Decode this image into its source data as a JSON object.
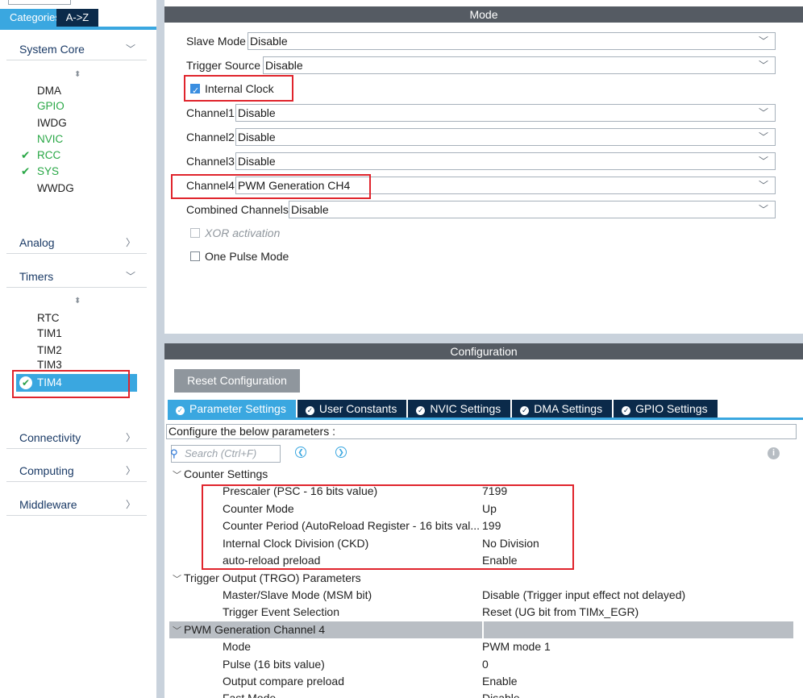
{
  "sidebar": {
    "tabs": {
      "categories": "Categories",
      "az": "A->Z"
    },
    "categories": [
      {
        "label": "System Core",
        "chevron": "﹀"
      },
      {
        "label": "Analog",
        "chevron": "〉"
      },
      {
        "label": "Timers",
        "chevron": "﹀"
      },
      {
        "label": "Connectivity",
        "chevron": "〉"
      },
      {
        "label": "Computing",
        "chevron": "〉"
      },
      {
        "label": "Middleware",
        "chevron": "〉"
      }
    ],
    "system_core_items": [
      "DMA",
      "GPIO",
      "IWDG",
      "NVIC",
      "RCC",
      "SYS",
      "WWDG"
    ],
    "timers_items": [
      "RTC",
      "TIM1",
      "TIM2",
      "TIM3",
      "TIM4"
    ],
    "sort_glyph": "⬍",
    "check_glyph": "✔"
  },
  "mode": {
    "header": "Mode",
    "slave_mode": {
      "label": "Slave Mode",
      "value": "Disable"
    },
    "trigger_source": {
      "label": "Trigger Source",
      "value": "Disable"
    },
    "internal_clock": {
      "label": "Internal Clock",
      "checked": true
    },
    "channel1": {
      "label": "Channel1",
      "value": "Disable"
    },
    "channel2": {
      "label": "Channel2",
      "value": "Disable"
    },
    "channel3": {
      "label": "Channel3",
      "value": "Disable"
    },
    "channel4": {
      "label": "Channel4",
      "value": "PWM Generation CH4"
    },
    "combined_channels": {
      "label": "Combined Channels",
      "value": "Disable"
    },
    "xor_activation": {
      "label": "XOR activation",
      "checked": false,
      "enabled": false
    },
    "one_pulse_mode": {
      "label": "One Pulse Mode",
      "checked": false
    },
    "dropdown_glyph": "﹀"
  },
  "configuration": {
    "header": "Configuration",
    "reset_button": "Reset Configuration",
    "tabs": [
      "Parameter Settings",
      "User Constants",
      "NVIC Settings",
      "DMA Settings",
      "GPIO Settings"
    ],
    "instructions": "Configure the below parameters :",
    "search_placeholder": "Search (Ctrl+F)",
    "groups": {
      "counter": {
        "title": "Counter Settings",
        "params": [
          {
            "name": "Prescaler (PSC - 16 bits value)",
            "value": "7199"
          },
          {
            "name": "Counter Mode",
            "value": "Up"
          },
          {
            "name": "Counter Period (AutoReload Register - 16 bits val...",
            "value": "199"
          },
          {
            "name": "Internal Clock Division (CKD)",
            "value": "No Division"
          },
          {
            "name": "auto-reload preload",
            "value": "Enable"
          }
        ]
      },
      "trgo": {
        "title": "Trigger Output (TRGO) Parameters",
        "params": [
          {
            "name": "Master/Slave Mode (MSM bit)",
            "value": "Disable (Trigger input effect not delayed)"
          },
          {
            "name": "Trigger Event Selection",
            "value": "Reset (UG bit from TIMx_EGR)"
          }
        ]
      },
      "pwm": {
        "title": "PWM Generation Channel 4",
        "params": [
          {
            "name": "Mode",
            "value": "PWM mode 1"
          },
          {
            "name": "Pulse (16 bits value)",
            "value": "0"
          },
          {
            "name": "Output compare preload",
            "value": "Enable"
          },
          {
            "name": "Fast Mode",
            "value": "Disable"
          }
        ]
      }
    }
  },
  "colors": {
    "accent": "#3aa7e0",
    "dark_tab": "#0b2a4a",
    "header": "#555b63",
    "highlight_box": "#e0242c",
    "ok_green": "#28a745"
  }
}
